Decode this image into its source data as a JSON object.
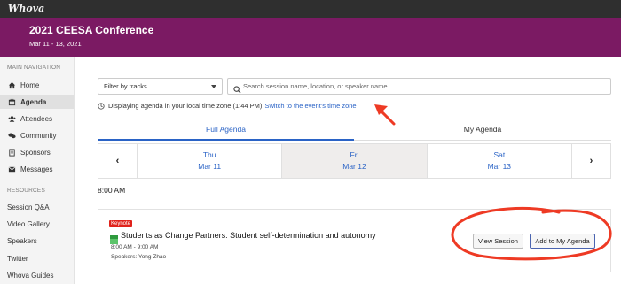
{
  "app": {
    "logo_text": "Whova"
  },
  "event": {
    "title": "2021 CEESA Conference",
    "dates": "Mar 11 - 13, 2021"
  },
  "sidebar": {
    "main_heading": "MAIN NAVIGATION",
    "items": [
      {
        "label": "Home",
        "icon": "home-icon"
      },
      {
        "label": "Agenda",
        "icon": "agenda-icon",
        "active": true
      },
      {
        "label": "Attendees",
        "icon": "attendees-icon"
      },
      {
        "label": "Community",
        "icon": "community-icon"
      },
      {
        "label": "Sponsors",
        "icon": "sponsors-icon"
      },
      {
        "label": "Messages",
        "icon": "messages-icon"
      }
    ],
    "resources_heading": "RESOURCES",
    "resources": [
      "Session Q&A",
      "Video Gallery",
      "Speakers",
      "Twitter",
      "Whova Guides"
    ]
  },
  "filter": {
    "label": "Filter by tracks"
  },
  "search": {
    "placeholder": "Search session name, location, or speaker name..."
  },
  "timezone": {
    "text": "Displaying agenda in your local time zone (1:44 PM)",
    "link": "Switch to the event's time zone"
  },
  "tabs": [
    {
      "label": "Full Agenda",
      "active": true
    },
    {
      "label": "My Agenda",
      "active": false
    }
  ],
  "days": [
    {
      "dow": "Thu",
      "date": "Mar 11"
    },
    {
      "dow": "Fri",
      "date": "Mar 12",
      "selected": true
    },
    {
      "dow": "Sat",
      "date": "Mar 13"
    }
  ],
  "arrows": {
    "prev": "‹",
    "next": "›"
  },
  "agenda": {
    "time_heading": "8:00 AM",
    "session": {
      "badge": "Keynote",
      "title": "Students as Change Partners: Student self-determination and autonomy",
      "time": "8:00 AM - 9:00 AM",
      "speakers": "Speakers: Yong Zhao",
      "view_label": "View Session",
      "add_label": "Add to My Agenda"
    }
  },
  "colors": {
    "banner": "#7b1a63",
    "accent": "#2a63c6",
    "badge": "#e0221b",
    "annotation": "#ee3a24"
  }
}
